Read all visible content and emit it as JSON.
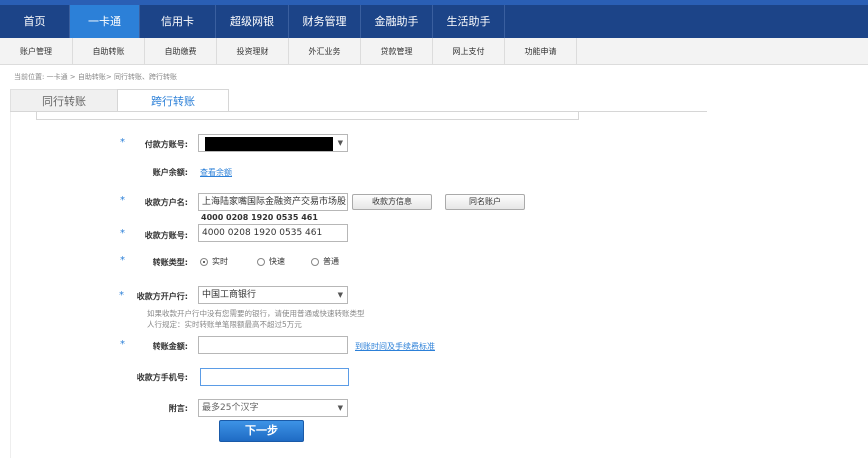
{
  "main_nav": [
    {
      "label": "首页",
      "active": false
    },
    {
      "label": "一卡通",
      "active": true
    },
    {
      "label": "信用卡",
      "active": false
    },
    {
      "label": "超级网银",
      "active": false
    },
    {
      "label": "财务管理",
      "active": false
    },
    {
      "label": "金融助手",
      "active": false
    },
    {
      "label": "生活助手",
      "active": false
    }
  ],
  "sub_nav": [
    "账户管理",
    "自助转账",
    "自助缴费",
    "投资理财",
    "外汇业务",
    "贷款管理",
    "网上支付",
    "功能申请"
  ],
  "breadcrumb": "当前位置: 一卡通 > 自助转账> 同行转账、跨行转账",
  "tabs": {
    "inactive": "同行转账",
    "active": "跨行转账"
  },
  "form": {
    "required_mark": "*",
    "payer_account_label": "付款方账号:",
    "balance_label": "账户余额:",
    "balance_link": "查看余额",
    "payee_name_label": "收款方户名:",
    "payee_name_value": "上海陆家嘴国际金融资产交易市场股",
    "payee_info_button": "收款方信息",
    "same_name_button": "同名账户",
    "payee_account_hint": "4000 0208 1920 0535 461",
    "payee_account_label": "收款方账号:",
    "payee_account_value": "4000 0208 1920 0535 461",
    "transfer_type_label": "转账类型:",
    "transfer_types": [
      {
        "label": "实时",
        "checked": true
      },
      {
        "label": "快速",
        "checked": false
      },
      {
        "label": "普通",
        "checked": false
      }
    ],
    "payee_bank_label": "收款方开户行:",
    "payee_bank_value": "中国工商银行",
    "bank_hint_1": "如果收款开户行中没有您需要的银行，请使用普通或快速转账类型",
    "bank_hint_2": "人行规定：实时转账单笔限额最高不超过5万元",
    "amount_label": "转账金额:",
    "amount_value": "",
    "fee_link": "到账时间及手续费标准",
    "phone_label": "收款方手机号:",
    "phone_value": "",
    "remark_label": "附言:",
    "remark_placeholder": "最多25个汉字",
    "submit_label": "下一步"
  },
  "colors": {
    "nav_bg": "#1c4488",
    "nav_active": "#2c80d8",
    "accent": "#2c80d8"
  }
}
